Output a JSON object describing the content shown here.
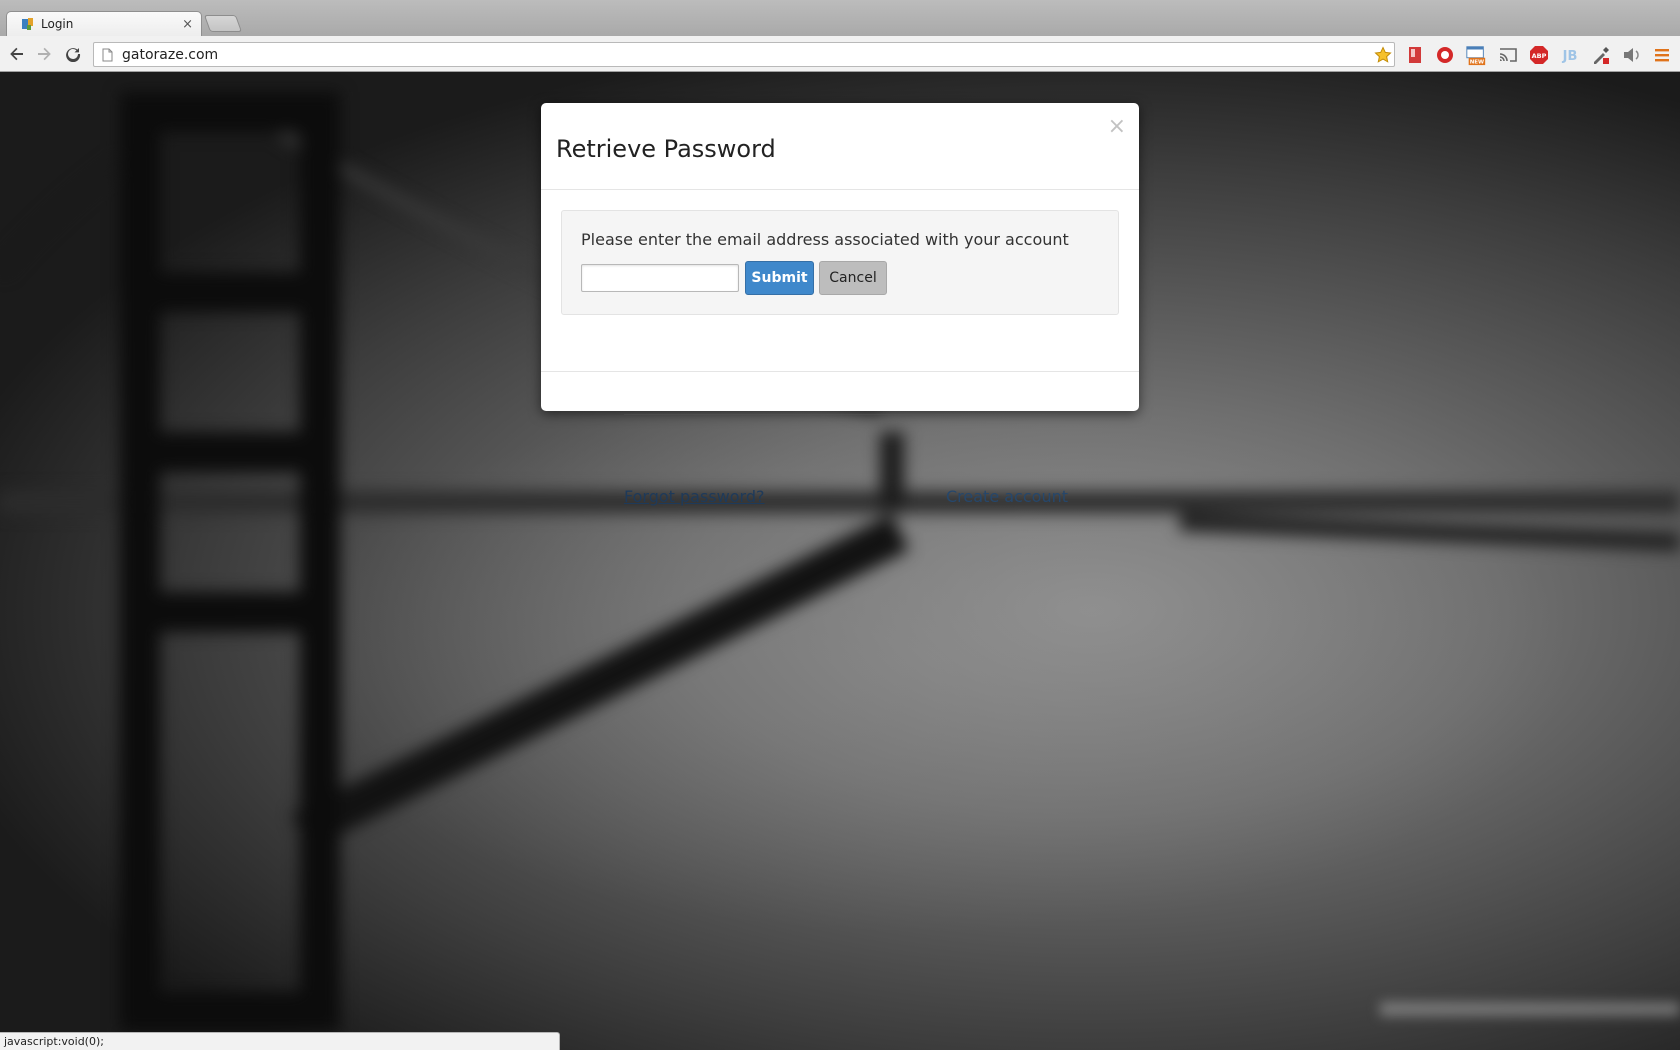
{
  "browser": {
    "tab_title": "Login",
    "tab_close": "×",
    "url": "gatoraze.com",
    "status_text": "javascript:void(0);",
    "extensions": [
      "bookmark-icon",
      "record-icon",
      "new-window-icon",
      "cast-icon",
      "adblock-icon",
      "jb-icon",
      "eyedropper-icon",
      "speaker-icon",
      "menu-icon"
    ],
    "ext_labels": {
      "adblock": "ABP",
      "jb": "JB",
      "new": "NEW"
    }
  },
  "page": {
    "forgot_password": "Forgot password?",
    "create_account": "Create account"
  },
  "modal": {
    "title": "Retrieve Password",
    "close": "×",
    "prompt": "Please enter the email address associated with your account",
    "email_value": "",
    "submit_label": "Submit",
    "cancel_label": "Cancel"
  },
  "colors": {
    "submit_bg": "#3f88cb",
    "cancel_bg": "#bdbdbd",
    "link": "#26476b"
  }
}
